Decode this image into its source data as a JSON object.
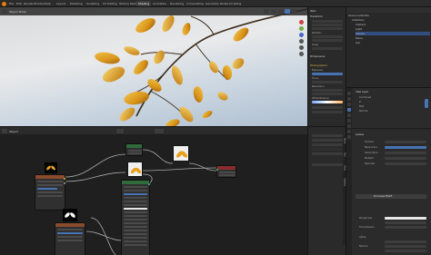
{
  "menu": {
    "items": [
      "File",
      "Edit",
      "Render",
      "Window",
      "Help"
    ]
  },
  "workspaces": {
    "tabs": [
      "Layout",
      "Modeling",
      "Sculpting",
      "UV Editing",
      "Texture Paint",
      "Shading",
      "Animation",
      "Rendering",
      "Compositing",
      "Geometry Nodes",
      "Scripting"
    ],
    "active": "Shading"
  },
  "viewport": {
    "mode_label": "Object Mode"
  },
  "npanel": {
    "sections": [
      "Item",
      "Transform",
      "Dimensions",
      "Photographer"
    ],
    "rows": [
      "Location",
      "Rotation",
      "Scale",
      "Exposure",
      "Focus",
      "Resolution",
      "White Balance"
    ]
  },
  "outliner": {
    "title": "Scene Collection",
    "rows": [
      "Collection",
      "Camera",
      "Light",
      "Leaves",
      "Plane",
      "Sun"
    ]
  },
  "properties": {
    "section_view_layer": "View Layer",
    "passes": [
      "Combined",
      "Z",
      "Mist",
      "Normal"
    ],
    "material_slot": "Leaves",
    "surface_label": "Surface",
    "rows": [
      "Surface",
      "Base Color",
      "Subsurface",
      "Metallic",
      "Specular",
      "Roughness",
      "Transmission",
      "Alpha",
      "Normal"
    ],
    "shader_name": "Principled BSDF"
  },
  "node_editor": {
    "header_label": "Object",
    "side_tabs": [
      "Node",
      "Tool",
      "View",
      "Options"
    ]
  },
  "colors": {
    "accent": "#4772b3",
    "node_image": "#8a4a2c",
    "node_shader": "#2f6b3c",
    "node_output": "#8a2d2d",
    "wire": "#a9a9a9",
    "socket_yellow": "#c7c729",
    "socket_grey": "#a1a1a1",
    "socket_green": "#39c884"
  }
}
